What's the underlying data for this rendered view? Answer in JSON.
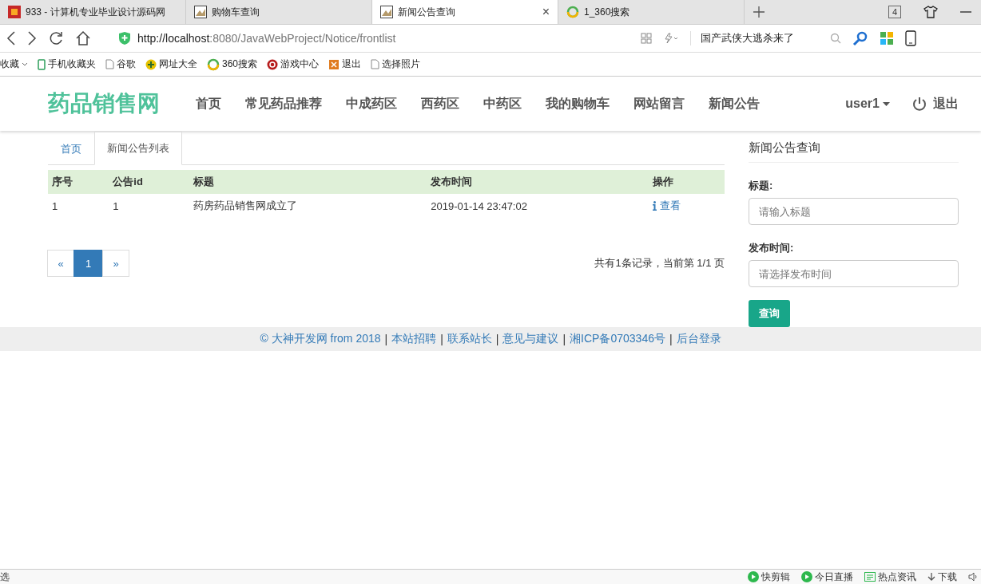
{
  "browser": {
    "tabs": [
      {
        "title": "933 - 计算机专业毕业设计源码网",
        "kind": "red",
        "selected": false
      },
      {
        "title": "购物车查询",
        "kind": "page",
        "selected": false
      },
      {
        "title": "新闻公告查询",
        "kind": "page",
        "selected": true
      },
      {
        "title": "1_360搜索",
        "kind": "ring",
        "selected": false
      }
    ],
    "tab_close": "×",
    "tab_count": "4",
    "url_host": "http://localhost",
    "url_rest": ":8080/JavaWebProject/Notice/frontlist",
    "search_text": "国产武侠大逃杀来了",
    "bookmarks": [
      {
        "label": "收藏",
        "kind": "menu"
      },
      {
        "label": "手机收藏夹",
        "kind": "phone"
      },
      {
        "label": "谷歌",
        "kind": "page"
      },
      {
        "label": "网址大全",
        "kind": "plus"
      },
      {
        "label": "360搜索",
        "kind": "ring"
      },
      {
        "label": "游戏中心",
        "kind": "game"
      },
      {
        "label": "退出",
        "kind": "box"
      },
      {
        "label": "选择照片",
        "kind": "page"
      }
    ]
  },
  "navbar": {
    "brand": "药品销售网",
    "items": [
      {
        "label": "首页"
      },
      {
        "label": "常见药品推荐"
      },
      {
        "label": "中成药区"
      },
      {
        "label": "西药区"
      },
      {
        "label": "中药区"
      },
      {
        "label": "我的购物车"
      },
      {
        "label": "网站留言"
      },
      {
        "label": "新闻公告"
      }
    ],
    "user": "user1",
    "logout": "退出"
  },
  "breadcrumb": [
    {
      "label": "首页",
      "selected": false
    },
    {
      "label": "新闻公告列表",
      "selected": true
    }
  ],
  "table": {
    "columns": [
      "序号",
      "公告id",
      "标题",
      "发布时间",
      "操作"
    ],
    "rows": [
      {
        "cells": [
          "1",
          "1",
          "药房药品销售网成立了",
          "2019-01-14 23:47:02"
        ],
        "action": "查看"
      }
    ]
  },
  "pagination": {
    "prev": "«",
    "pages": [
      {
        "label": "1",
        "selected": true
      }
    ],
    "next": "»",
    "summary": "共有1条记录，当前第 1/1 页"
  },
  "sidebar": {
    "title": "新闻公告查询",
    "fields": [
      {
        "label": "标题:",
        "placeholder": "请输入标题"
      },
      {
        "label": "发布时间:",
        "placeholder": "请选择发布时间"
      }
    ],
    "button": "查询"
  },
  "footer": {
    "items": [
      {
        "text": "© 大神开发网 from 2018",
        "kind": "link"
      },
      {
        "text": "|",
        "kind": "separator"
      },
      {
        "text": "本站招聘",
        "kind": "link"
      },
      {
        "text": "|",
        "kind": "separator"
      },
      {
        "text": "联系站长",
        "kind": "link"
      },
      {
        "text": "|",
        "kind": "separator"
      },
      {
        "text": "意见与建议",
        "kind": "link"
      },
      {
        "text": "|",
        "kind": "separator"
      },
      {
        "text": "湘ICP备0703346号",
        "kind": "link"
      },
      {
        "text": "|",
        "kind": "separator"
      },
      {
        "text": "后台登录",
        "kind": "link"
      }
    ]
  },
  "status_bar": {
    "left": "选",
    "items": [
      {
        "label": "快剪辑",
        "kind": "play"
      },
      {
        "label": "今日直播",
        "kind": "play"
      },
      {
        "label": "热点资讯",
        "kind": "news"
      },
      {
        "label": "下载",
        "kind": "download"
      }
    ]
  }
}
